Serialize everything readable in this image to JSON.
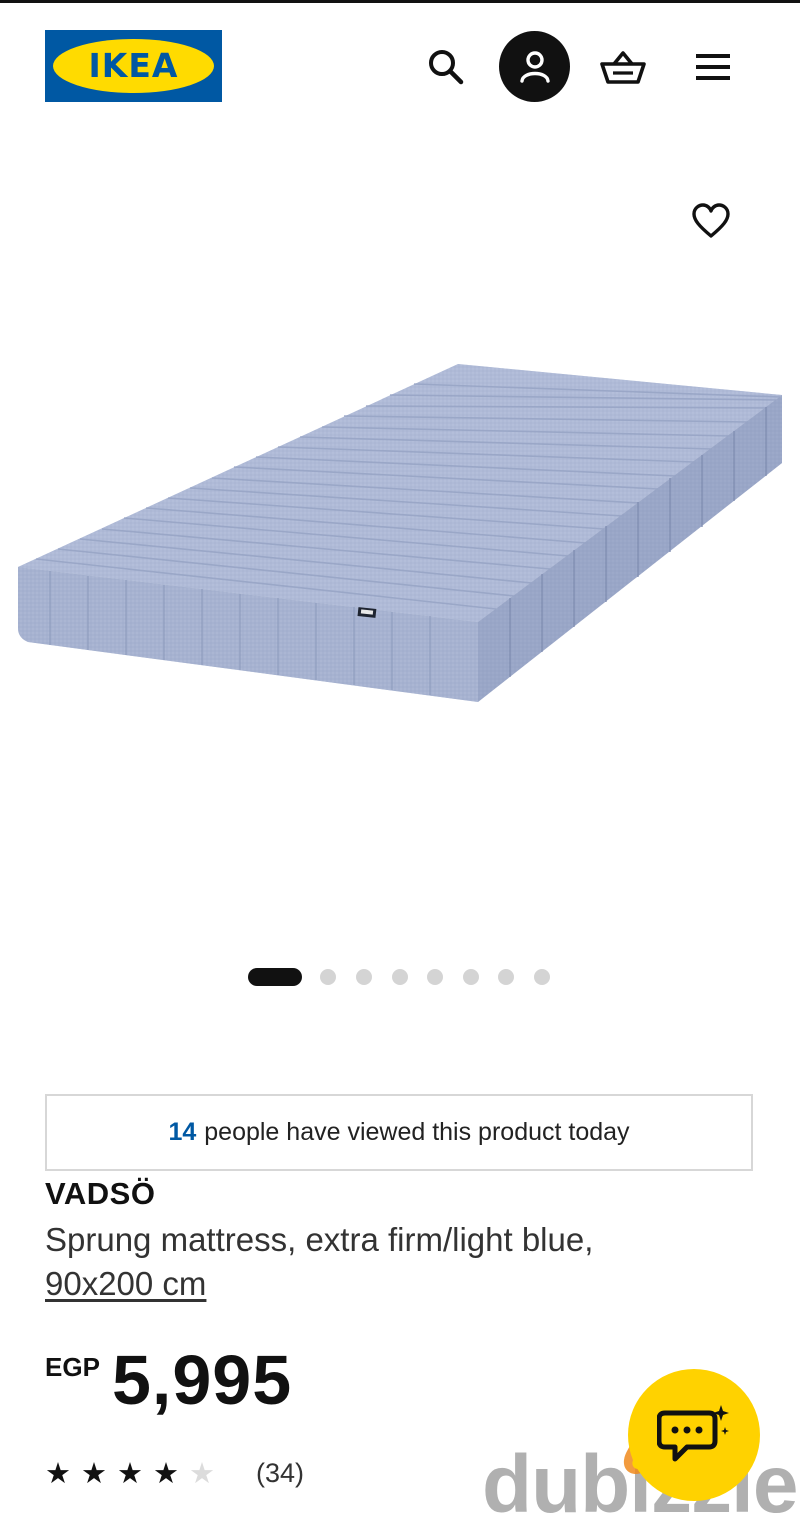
{
  "header": {
    "logo_text": "IKEA",
    "icons": [
      "search-icon",
      "account-icon",
      "shopping-bag-icon",
      "hamburger-menu-icon"
    ]
  },
  "product": {
    "image": {
      "alt": "mattress-image"
    },
    "gallery": {
      "total": 8,
      "active_index": 0
    },
    "viewers_count": "14",
    "viewers_text": "people have viewed this product today",
    "name": "VADSÖ",
    "description": "Sprung mattress, extra firm/light blue,",
    "size": "90x200 cm",
    "currency": "EGP",
    "price": "5,995",
    "rating": {
      "value": 4,
      "max": 5,
      "count": "(34)"
    }
  },
  "watermark": {
    "text": "dubizzle"
  },
  "colors": {
    "ikea_blue": "#0058a3",
    "ikea_yellow": "#ffdb00",
    "dubizzle_yellow": "#ffd200",
    "mattress_blue": "#a9b6d6"
  }
}
